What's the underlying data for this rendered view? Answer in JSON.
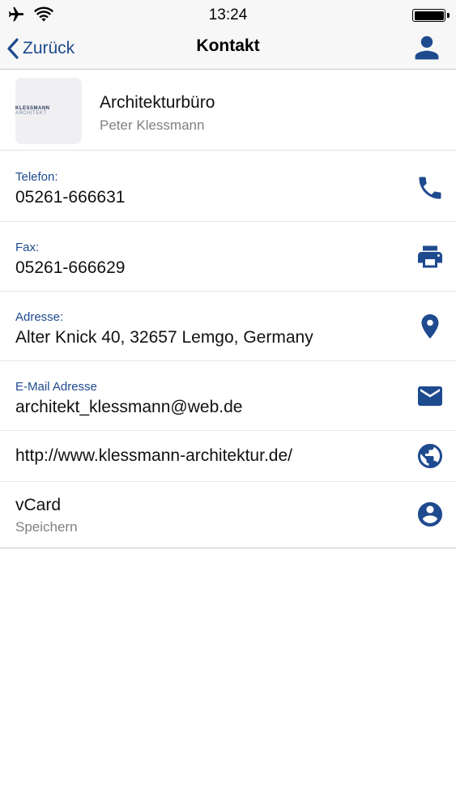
{
  "status_bar": {
    "time": "13:24",
    "icons": [
      "airplane-icon",
      "wifi-icon",
      "battery-icon"
    ]
  },
  "nav": {
    "back_label": "Zurück",
    "title": "Kontakt",
    "right_icon": "person-icon"
  },
  "header": {
    "logo_text_dark": "KLESSMANN",
    "logo_text_light": "ARCHITEKT",
    "company": "Architekturbüro",
    "person": "Peter Klessmann"
  },
  "contacts": [
    {
      "label": "Telefon:",
      "value": "05261-666631",
      "icon": "phone-icon"
    },
    {
      "label": "Fax:",
      "value": "05261-666629",
      "icon": "printer-icon"
    },
    {
      "label": "Adresse:",
      "value": "Alter Knick 40, 32657 Lemgo, Germany",
      "icon": "location-pin-icon"
    },
    {
      "label": "E-Mail Adresse",
      "value": "architekt_klessmann@web.de",
      "icon": "mail-icon"
    },
    {
      "value": "http://www.klessmann-architektur.de/",
      "icon": "globe-icon"
    },
    {
      "value": "vCard",
      "sub": "Speichern",
      "icon": "account-circle-icon"
    }
  ],
  "colors": {
    "accent": "#1e4a8e",
    "label": "#1e4a8e",
    "secondary_text": "#808080",
    "bar_background": "#f7f7f7"
  }
}
